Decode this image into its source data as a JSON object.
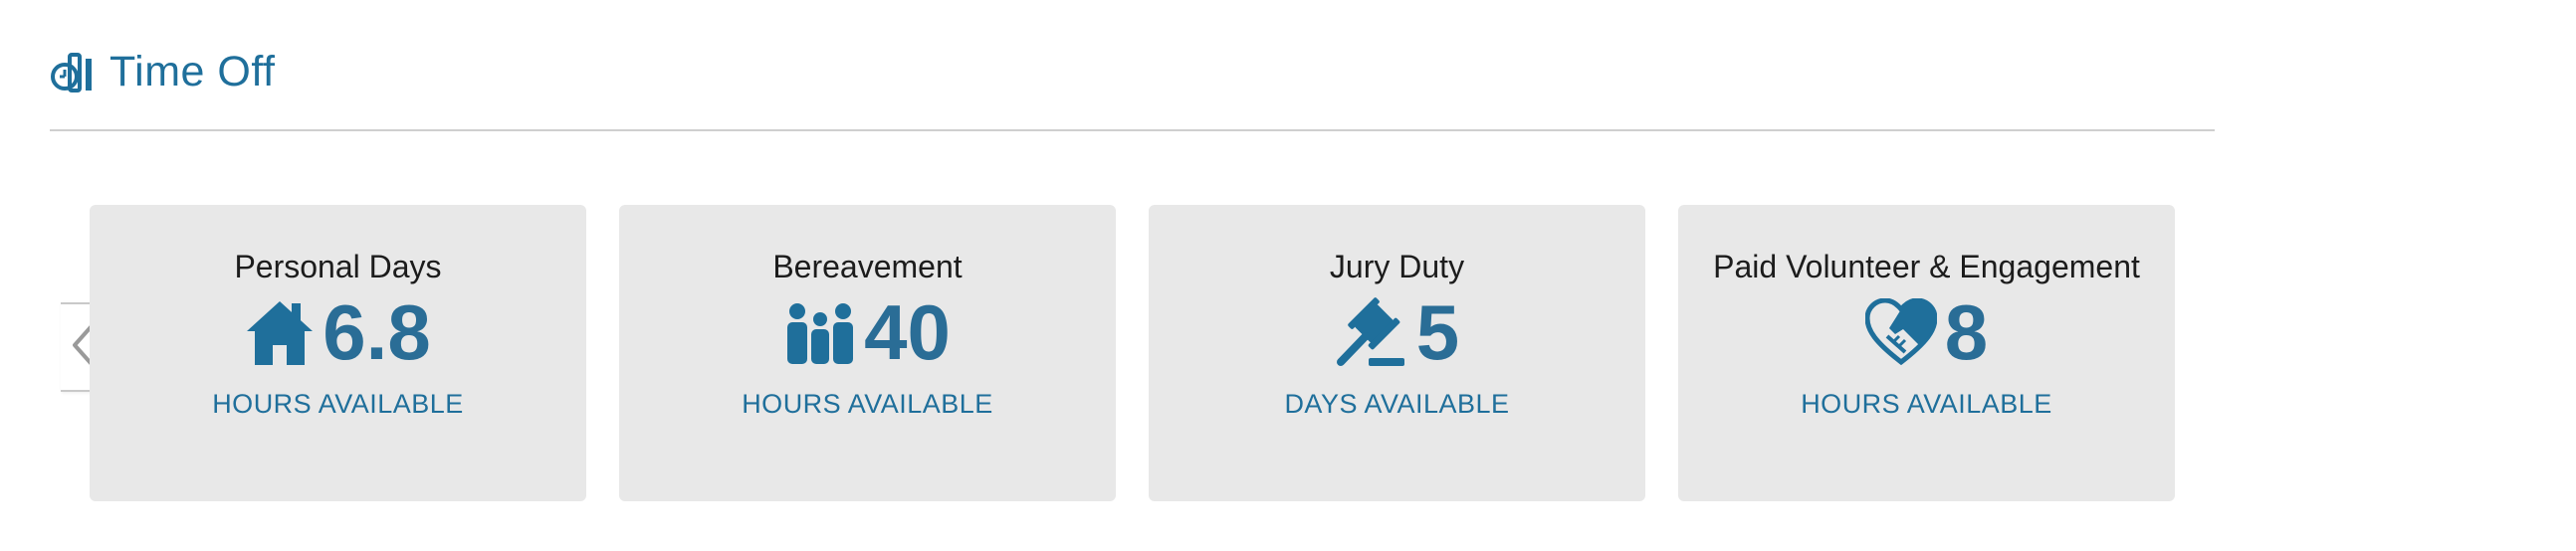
{
  "section": {
    "title": "Time Off",
    "icon": "timeoff-clock-icon"
  },
  "colors": {
    "accent": "#1f6f9b",
    "card_bg": "#e8e8e8",
    "divider": "#cfcfcf"
  },
  "carousel": {
    "prev_icon": "chevron-left-icon",
    "cards": [
      {
        "title": "Personal Days",
        "value": "6.8",
        "unit": "HOURS AVAILABLE",
        "icon": "house-icon"
      },
      {
        "title": "Bereavement",
        "value": "40",
        "unit": "HOURS AVAILABLE",
        "icon": "family-icon"
      },
      {
        "title": "Jury Duty",
        "value": "5",
        "unit": "DAYS AVAILABLE",
        "icon": "gavel-icon"
      },
      {
        "title": "Paid Volunteer & Engagement",
        "value": "8",
        "unit": "HOURS AVAILABLE",
        "icon": "heart-handshake-icon"
      }
    ]
  }
}
